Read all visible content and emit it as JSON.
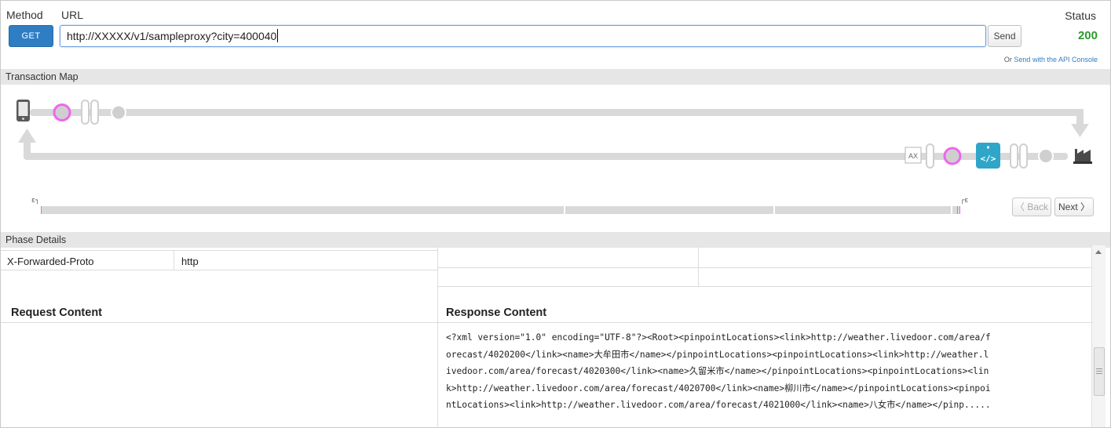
{
  "header": {
    "method_label": "Method",
    "url_label": "URL",
    "method_button": "GET",
    "url_value": "http://XXXXX/v1/sampleproxy?city=400040",
    "send_label": "Send",
    "status_label": "Status",
    "status_value": "200",
    "console_prefix": "Or",
    "console_link": "Send with the API Console"
  },
  "transaction_map": {
    "title": "Transaction Map",
    "ax_label": "AX",
    "timeline_start_marker": "ε┐",
    "timeline_end_marker": "┌ε",
    "back_label": "〈 Back",
    "next_label": "Next 〉"
  },
  "phase_details": {
    "title": "Phase Details",
    "header_name": "X-Forwarded-Proto",
    "header_value": "http",
    "request_title": "Request Content",
    "response_title": "Response Content",
    "response_lines": [
      "<?xml version=\"1.0\" encoding=\"UTF-8\"?><Root><pinpointLocations><link>http://weather.livedoor.com/area/f",
      "orecast/4020200</link><name>大牟田市</name></pinpointLocations><pinpointLocations><link>http://weather.l",
      "ivedoor.com/area/forecast/4020300</link><name>久留米市</name></pinpointLocations><pinpointLocations><lin",
      "k>http://weather.livedoor.com/area/forecast/4020700</link><name>柳川市</name></pinpointLocations><pinpoi",
      "ntLocations><link>http://weather.livedoor.com/area/forecast/4021000</link><name>八女市</name></pinp....."
    ]
  },
  "colors": {
    "accent": "#2f7ec3",
    "status_ok": "#2e9a2e",
    "policy_pink": "#ee66ee",
    "target_teal": "#2fa6c8",
    "track_gray": "#d9d9d9"
  }
}
